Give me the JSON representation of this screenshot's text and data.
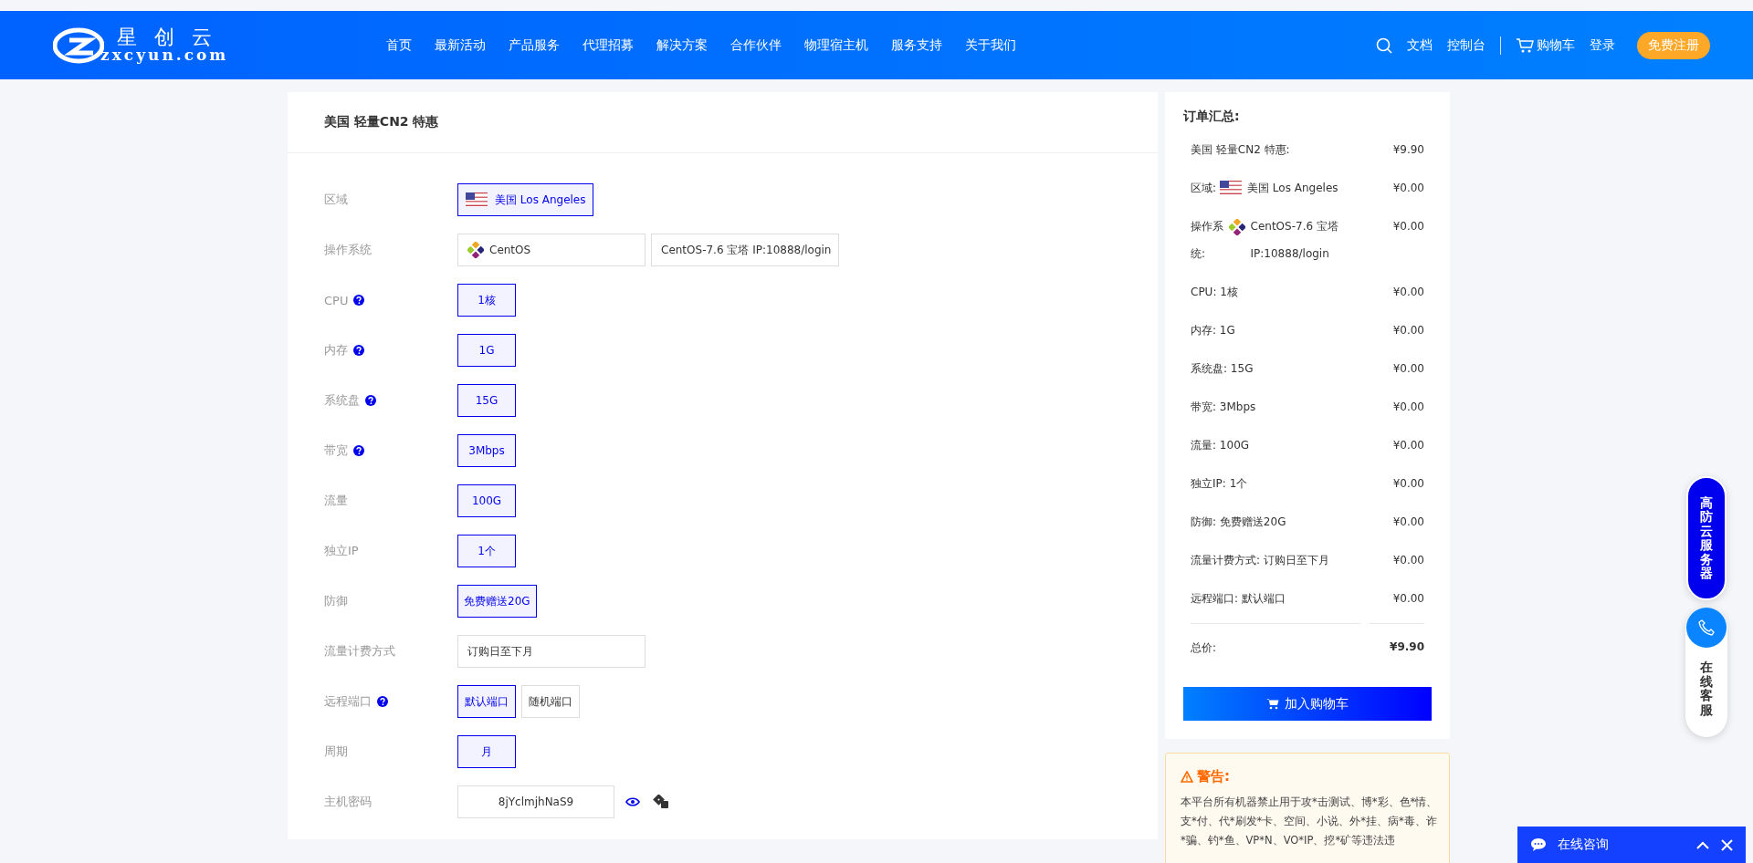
{
  "header": {
    "logo": {
      "brand": "星 创 云",
      "domain": "zxcyun.com"
    },
    "nav": [
      "首页",
      "最新活动",
      "产品服务",
      "代理招募",
      "解决方案",
      "合作伙伴",
      "物理宿主机",
      "服务支持",
      "关于我们"
    ],
    "links": [
      "文档",
      "控制台"
    ],
    "cart": "购物车",
    "login": "登录",
    "register": "免费注册"
  },
  "product": {
    "title": "美国 轻量CN2 特惠",
    "fields": [
      {
        "kind": "region",
        "label": "区域",
        "help": false,
        "options": [
          {
            "text": "美国 Los Angeles",
            "selected": true
          }
        ]
      },
      {
        "kind": "os",
        "label": "操作系统",
        "help": false,
        "value": "CentOS",
        "version": "CentOS-7.6 宝塔 IP:10888/login"
      },
      {
        "kind": "options",
        "label": "CPU",
        "help": true,
        "options": [
          {
            "text": "1核",
            "selected": true
          }
        ]
      },
      {
        "kind": "options",
        "label": "内存",
        "help": true,
        "options": [
          {
            "text": "1G",
            "selected": true
          }
        ]
      },
      {
        "kind": "options",
        "label": "系统盘",
        "help": true,
        "options": [
          {
            "text": "15G",
            "selected": true
          }
        ]
      },
      {
        "kind": "options",
        "label": "带宽",
        "help": true,
        "options": [
          {
            "text": "3Mbps",
            "selected": true
          }
        ]
      },
      {
        "kind": "options",
        "label": "流量",
        "help": false,
        "options": [
          {
            "text": "100G",
            "selected": true
          }
        ]
      },
      {
        "kind": "options",
        "label": "独立IP",
        "help": false,
        "options": [
          {
            "text": "1个",
            "selected": true
          }
        ]
      },
      {
        "kind": "options",
        "label": "防御",
        "help": false,
        "options": [
          {
            "text": "免费赠送20G",
            "selected": true
          }
        ]
      },
      {
        "kind": "display",
        "label": "流量计费方式",
        "help": false,
        "value": "订购日至下月"
      },
      {
        "kind": "options",
        "label": "远程端口",
        "help": true,
        "options": [
          {
            "text": "默认端口",
            "selected": true
          },
          {
            "text": "随机端口",
            "selected": false
          }
        ]
      },
      {
        "kind": "options",
        "label": "周期",
        "help": false,
        "options": [
          {
            "text": "月",
            "selected": true
          }
        ]
      },
      {
        "kind": "password",
        "label": "主机密码",
        "help": false,
        "value": "8jYclmjhNaS9"
      }
    ]
  },
  "summary": {
    "title": "订单汇总:",
    "items": [
      {
        "kind": "plain",
        "label": "美国 轻量CN2 特惠:",
        "price": "¥9.90"
      },
      {
        "kind": "region",
        "label": "区域:",
        "value": "美国 Los Angeles",
        "price": "¥0.00"
      },
      {
        "kind": "os",
        "label": "操作系统:",
        "value": "CentOS-7.6 宝塔 IP:10888/login",
        "price": "¥0.00"
      },
      {
        "kind": "plain",
        "label": "CPU: 1核",
        "price": "¥0.00"
      },
      {
        "kind": "plain",
        "label": "内存: 1G",
        "price": "¥0.00"
      },
      {
        "kind": "plain",
        "label": "系统盘: 15G",
        "price": "¥0.00"
      },
      {
        "kind": "plain",
        "label": "带宽: 3Mbps",
        "price": "¥0.00"
      },
      {
        "kind": "plain",
        "label": "流量: 100G",
        "price": "¥0.00"
      },
      {
        "kind": "plain",
        "label": "独立IP: 1个",
        "price": "¥0.00"
      },
      {
        "kind": "plain",
        "label": "防御: 免费赠送20G",
        "price": "¥0.00"
      },
      {
        "kind": "plain",
        "label": "流量计费方式: 订购日至下月",
        "price": "¥0.00"
      },
      {
        "kind": "plain",
        "label": "远程端口: 默认端口",
        "price": "¥0.00"
      }
    ],
    "total_label": "总价:",
    "total": "¥9.90",
    "button": "加入购物车"
  },
  "warning": {
    "title": "警告:",
    "text": "本平台所有机器禁止用于攻*击测试、博*彩、色*情、支*付、代*刷发*卡、空间、小说、外*挂、病*毒、诈*骗、钓*鱼、VP*N、VO*IP、挖*矿等违法违"
  },
  "float": {
    "promo": "高防云服务器",
    "support": "在线客服"
  },
  "chat": {
    "title": "在线咨询"
  }
}
